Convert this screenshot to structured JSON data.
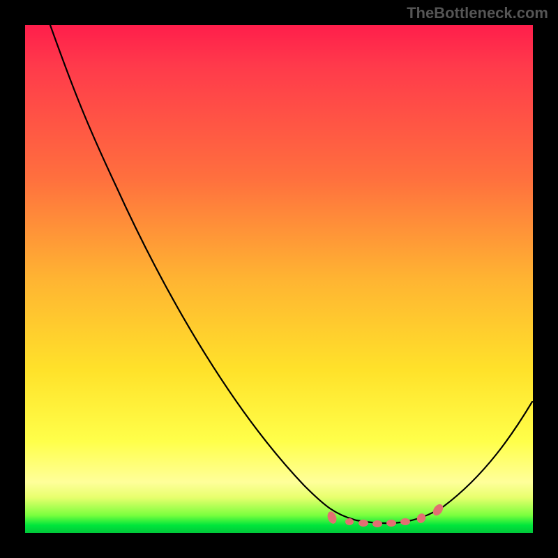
{
  "watermark": "TheBottleneck.com",
  "colors": {
    "background": "#000000",
    "gradient_top": "#ff1e4b",
    "gradient_mid": "#ffe22a",
    "gradient_bottom": "#00c83a",
    "curve": "#000000",
    "markers": "#e26f72",
    "watermark_text": "#555555"
  },
  "chart_data": {
    "type": "line",
    "title": "",
    "xlabel": "",
    "ylabel": "",
    "xlim": [
      0,
      100
    ],
    "ylim": [
      0,
      100
    ],
    "grid": false,
    "legend": null,
    "description": "V-shaped bottleneck curve over a red-to-green performance gradient. Lower y is better (green zone). Minimum of the curve occurs around x≈70.",
    "series": [
      {
        "name": "bottleneck-curve",
        "x": [
          5,
          10,
          18,
          30,
          45,
          55,
          60,
          65,
          70,
          75,
          80,
          88,
          95,
          100
        ],
        "y": [
          100,
          92,
          78,
          60,
          38,
          22,
          12,
          5,
          2,
          2,
          5,
          12,
          20,
          26
        ]
      }
    ],
    "markers": {
      "name": "highlighted-points",
      "color": "#e26f72",
      "x": [
        60,
        64,
        67,
        70,
        73,
        76,
        79,
        82
      ],
      "y": [
        3,
        2,
        2,
        2,
        2,
        2,
        3,
        5
      ]
    }
  }
}
